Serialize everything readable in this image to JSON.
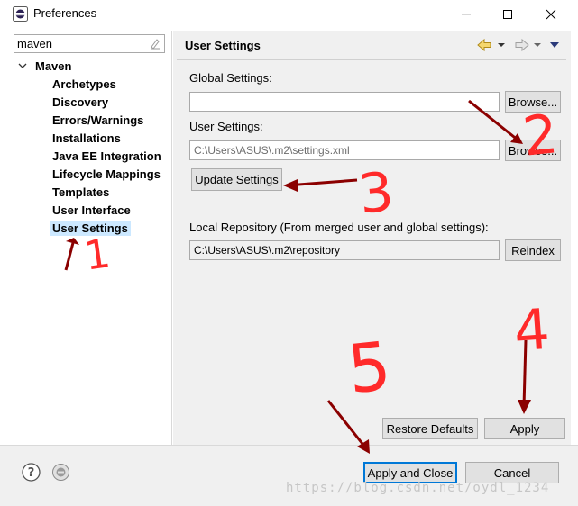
{
  "window": {
    "title": "Preferences",
    "icons": {
      "app": "eclipse-icon",
      "minimize": "minimize-icon",
      "maximize": "maximize-icon",
      "close": "close-icon"
    }
  },
  "filter": {
    "value": "maven",
    "clear_icon": "clear-filter-icon"
  },
  "tree": {
    "root": "Maven",
    "items": [
      {
        "label": "Archetypes"
      },
      {
        "label": "Discovery"
      },
      {
        "label": "Errors/Warnings"
      },
      {
        "label": "Installations"
      },
      {
        "label": "Java EE Integration"
      },
      {
        "label": "Lifecycle Mappings"
      },
      {
        "label": "Templates"
      },
      {
        "label": "User Interface"
      },
      {
        "label": "User Settings",
        "selected": true
      }
    ]
  },
  "page": {
    "title": "User Settings",
    "global_settings_label": "Global Settings:",
    "global_settings_value": "",
    "browse_label": "Browse...",
    "user_settings_label": "User Settings:",
    "user_settings_value": "C:\\Users\\ASUS\\.m2\\settings.xml",
    "update_settings_label": "Update Settings",
    "local_repo_label": "Local Repository (From merged user and global settings):",
    "local_repo_value": "C:\\Users\\ASUS\\.m2\\repository",
    "reindex_label": "Reindex",
    "restore_defaults_label": "Restore Defaults",
    "apply_label": "Apply"
  },
  "footer": {
    "apply_close_label": "Apply and Close",
    "cancel_label": "Cancel",
    "watermark": "https://blog.csdn.net/oydl_1234"
  },
  "annotations": [
    "1",
    "2",
    "3",
    "4",
    "5"
  ],
  "colors": {
    "selection": "#cce8ff",
    "annotation_red": "#ff2a2a",
    "arrow_dark_red": "#8b0000",
    "focus_blue": "#0078d7"
  }
}
